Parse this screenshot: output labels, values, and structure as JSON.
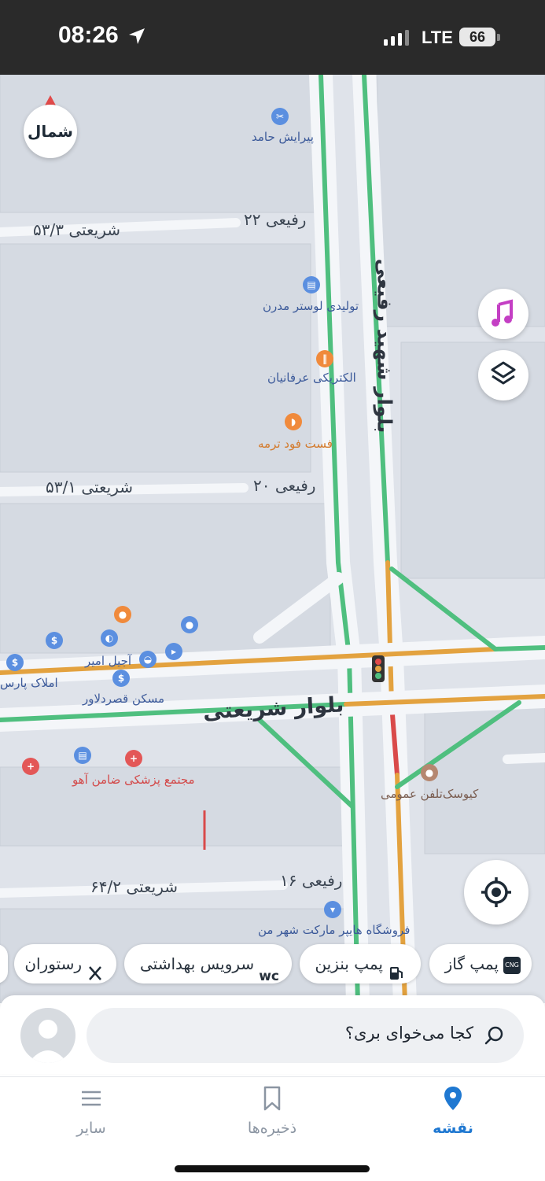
{
  "status_bar": {
    "time": "08:26",
    "network": "LTE",
    "battery": "66"
  },
  "map": {
    "compass_label": "شمال",
    "street_labels": [
      {
        "id": "shariati-53-3",
        "text": "شریعتی ۵۳/۳"
      },
      {
        "id": "rafiee-22",
        "text": "رفیعی ۲۲"
      },
      {
        "id": "shariati-53-1",
        "text": "شریعتی ۵۳/۱"
      },
      {
        "id": "rafiee-20",
        "text": "رفیعی ۲۰"
      },
      {
        "id": "shariati-64-2",
        "text": "شریعتی ۶۴/۲"
      },
      {
        "id": "rafiee-16",
        "text": "رفیعی ۱۶"
      },
      {
        "id": "blvd-rafiee",
        "text": "بلوار شهید رفیعی"
      },
      {
        "id": "blvd-shariati",
        "text": "بلوار شریعتی"
      }
    ],
    "places": [
      {
        "id": "hamed",
        "text": "پیرایش حامد"
      },
      {
        "id": "luster",
        "text": "تولیدی لوستر مدرن"
      },
      {
        "id": "erfanian",
        "text": "الکتریکی عرفانیان"
      },
      {
        "id": "fastfood",
        "text": "فست فود ترمه"
      },
      {
        "id": "ajil",
        "text": "آجیل امیر"
      },
      {
        "id": "amlak",
        "text": "املاک پارس"
      },
      {
        "id": "maskan",
        "text": "مسکن قصردلاور"
      },
      {
        "id": "clinic",
        "text": "مجتمع پزشکی ضامن آهو"
      },
      {
        "id": "kiosk",
        "text": "کیوسک‌تلفن عمومی"
      },
      {
        "id": "hypermarket",
        "text": "فروشگاه هایپر مارکت شهر من"
      }
    ]
  },
  "chips": [
    {
      "label": "پمپ گاز",
      "icon": "cng-icon"
    },
    {
      "label": "پمپ بنزین",
      "icon": "fuel-pump-icon"
    },
    {
      "label": "سرویس بهداشتی",
      "icon": "wc-icon",
      "icon_text": "wc"
    },
    {
      "label": "رستوران",
      "icon": "restaurant-icon"
    }
  ],
  "search": {
    "placeholder": "کجا می‌خوای بری؟"
  },
  "nav": {
    "tabs": [
      {
        "label": "نقشه",
        "icon": "map-pin-icon",
        "active": true
      },
      {
        "label": "ذخیره‌ها",
        "icon": "bookmark-icon",
        "active": false
      },
      {
        "label": "سایر",
        "icon": "menu-icon",
        "active": false
      }
    ]
  },
  "colors": {
    "accent": "#1f78d1",
    "traffic_green": "#4fbf7f",
    "traffic_orange": "#e3a23f",
    "traffic_red": "#d94a4a"
  }
}
